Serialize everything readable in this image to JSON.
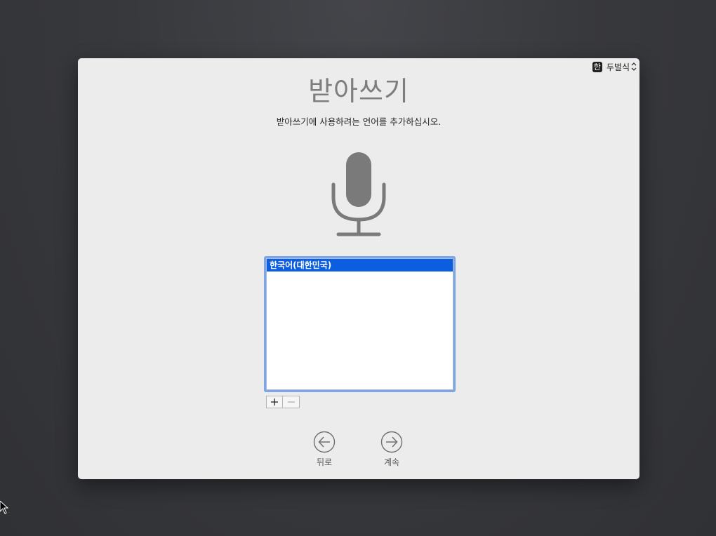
{
  "input_menu": {
    "badge": "한",
    "label": "두벌식",
    "chevron_icon": "updown-chevron-icon"
  },
  "title": "받아쓰기",
  "subtitle": "받아쓰기에 사용하려는 언어를 추가하십시오.",
  "microphone_icon": "microphone-icon",
  "languages": {
    "items": [
      {
        "label": "한국어(대한민국)",
        "selected": true
      }
    ]
  },
  "list_controls": {
    "add_icon": "plus-icon",
    "remove_icon": "minus-icon"
  },
  "navigation": {
    "back_label": "뒤로",
    "continue_label": "계속"
  },
  "colors": {
    "selection": "#0b5ee0",
    "focus_ring": "#7ea6e6",
    "icon_gray": "#7a7a7a"
  }
}
